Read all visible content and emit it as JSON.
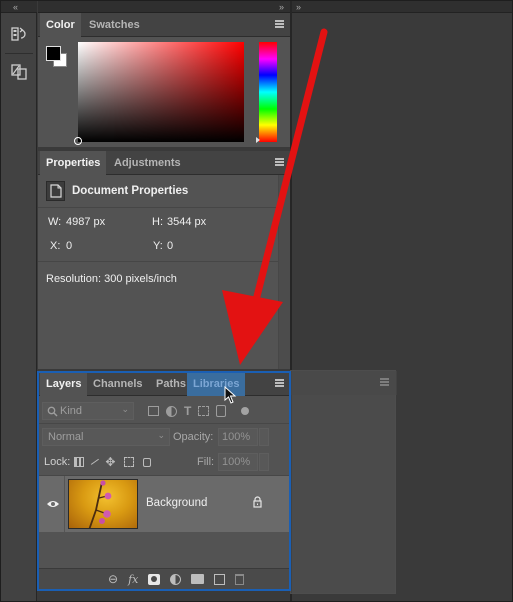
{
  "color_panel": {
    "tabs": [
      {
        "label": "Color"
      },
      {
        "label": "Swatches"
      }
    ],
    "foreground_color": "#000000",
    "background_color": "#ffffff",
    "hue": "#ff0000"
  },
  "properties_panel": {
    "tabs": [
      {
        "label": "Properties"
      },
      {
        "label": "Adjustments"
      }
    ],
    "section_title": "Document Properties",
    "w_label": "W:",
    "w_value": "4987 px",
    "h_label": "H:",
    "h_value": "3544 px",
    "x_label": "X:",
    "x_value": "0",
    "y_label": "Y:",
    "y_value": "0",
    "resolution": "Resolution: 300 pixels/inch"
  },
  "layers_panel": {
    "tabs": [
      {
        "label": "Layers"
      },
      {
        "label": "Channels"
      },
      {
        "label": "Paths"
      },
      {
        "label": "Libraries"
      }
    ],
    "filter_kind": "Kind",
    "blend_mode": "Normal",
    "opacity_label": "Opacity:",
    "opacity_value": "100%",
    "lock_label": "Lock:",
    "fill_label": "Fill:",
    "fill_value": "100%",
    "layers": [
      {
        "name": "Background",
        "visible": true,
        "locked": true
      }
    ]
  },
  "accent_colors": {
    "selection": "#1a5fb4",
    "arrow": "#e31212"
  }
}
